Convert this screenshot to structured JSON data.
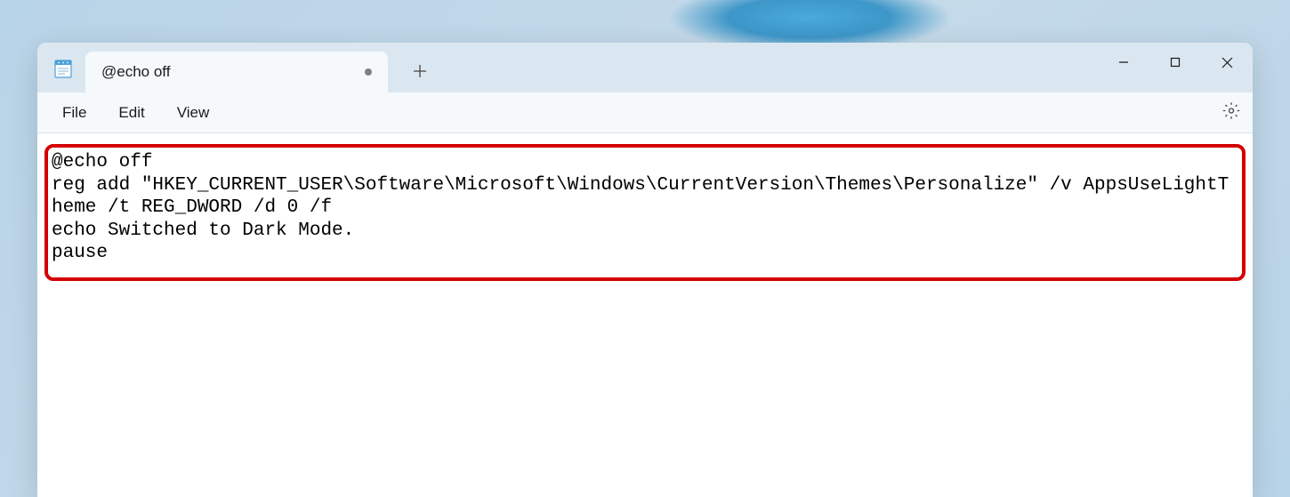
{
  "tab": {
    "title": "@echo off",
    "dirty": true
  },
  "menus": {
    "file": "File",
    "edit": "Edit",
    "view": "View"
  },
  "editor": {
    "content": "@echo off\nreg add \"HKEY_CURRENT_USER\\Software\\Microsoft\\Windows\\CurrentVersion\\Themes\\Personalize\" /v AppsUseLightTheme /t REG_DWORD /d 0 /f\necho Switched to Dark Mode.\npause"
  },
  "colors": {
    "highlight_border": "#d40000",
    "titlebar_bg": "#dbe7f0",
    "window_bg": "#f5f9fc"
  }
}
